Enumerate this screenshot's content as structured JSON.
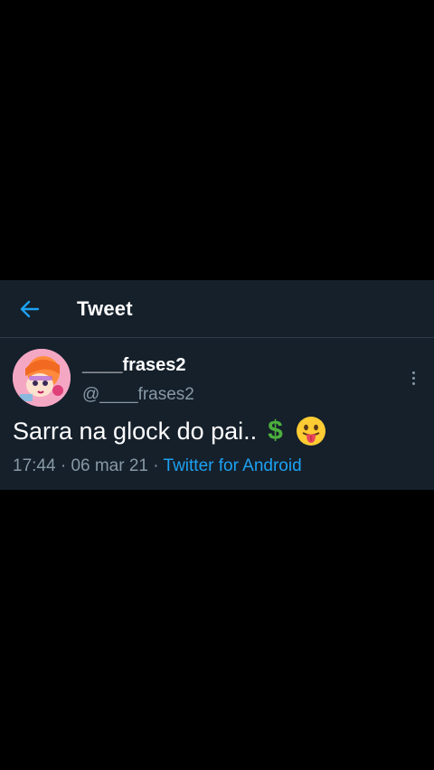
{
  "header": {
    "back_icon": "arrow-left-icon",
    "title": "Tweet"
  },
  "tweet": {
    "display_name": "____frases2",
    "handle": "@____frases2",
    "text": "Sarra na glock do pai..",
    "emojis": [
      "heavy-dollar-sign",
      "face-with-tongue"
    ],
    "dollar_glyph": "$",
    "time": "17:44",
    "date": "06 mar 21",
    "separator": "·",
    "source": "Twitter for Android"
  },
  "colors": {
    "background": "#15202b",
    "accent": "#1da1f2",
    "secondary_text": "#8899a6",
    "dollar_green": "#4caf3d"
  }
}
